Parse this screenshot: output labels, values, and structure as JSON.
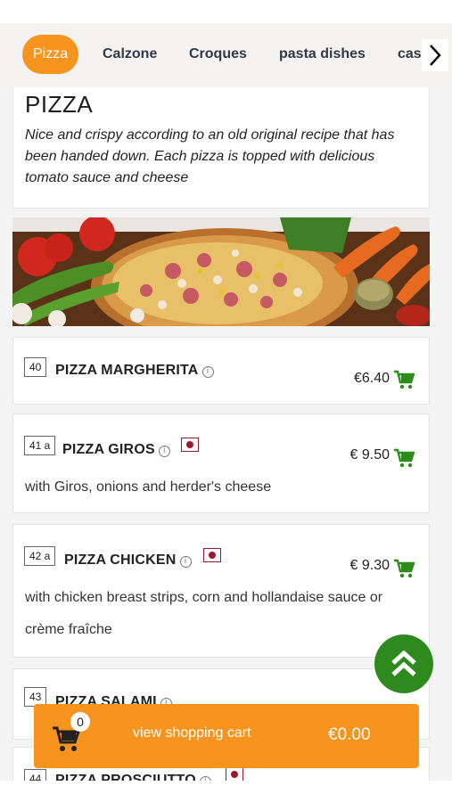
{
  "tabs": [
    {
      "label": "Pizza",
      "active": true
    },
    {
      "label": "Calzone",
      "active": false
    },
    {
      "label": "Croques",
      "active": false
    },
    {
      "label": "pasta dishes",
      "active": false
    },
    {
      "label": "cass",
      "active": false
    }
  ],
  "section": {
    "title": "PIZZA",
    "description": "Nice and crispy according to an old original recipe that has been handed down. Each pizza is topped with delicious tomato sauce and cheese"
  },
  "items": [
    {
      "number": "40",
      "name": "PIZZA MARGHERITA",
      "price": "€6.40",
      "description": "",
      "has_flag": false
    },
    {
      "number": "41 a",
      "name": "PIZZA GIROS",
      "price": "€ 9.50",
      "description": "with Giros, onions and herder's cheese",
      "has_flag": true
    },
    {
      "number": "42 a",
      "name": "PIZZA CHICKEN",
      "price": "€ 9.30",
      "description": "with chicken breast strips, corn and hollandaise sauce or crème fraîche",
      "has_flag": true
    },
    {
      "number": "43",
      "name": "PIZZA SALAMI",
      "price": "",
      "description": "",
      "has_flag": false
    },
    {
      "number": "44",
      "name": "PIZZA PROSCIUTTO",
      "price": "",
      "description": "",
      "has_flag": true
    }
  ],
  "cart": {
    "count": "0",
    "label": "view shopping cart",
    "total": "€0.00"
  },
  "icons": {
    "tab_scroll": "chevron-right-icon",
    "info": "info-icon",
    "flag": "allergen-flag-icon",
    "add_to_cart": "cart-add-icon",
    "scroll_top": "double-chevron-up-icon",
    "cart": "cart-icon"
  },
  "colors": {
    "accent": "#f7941d",
    "green": "#2f8a1e",
    "flag": "#9c1a2f"
  }
}
